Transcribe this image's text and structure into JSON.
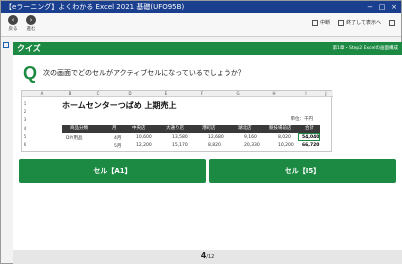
{
  "window": {
    "title": "【eラーニング】よくわかる Excel 2021 基礎(UFO95B)",
    "controls": [
      "−",
      "□",
      "×"
    ]
  },
  "toolbar": {
    "back_label": "戻る",
    "forward_label": "進む",
    "pause_label": "中断",
    "fullscreen_label": "終了して表示へ",
    "help_label": "?"
  },
  "quiz": {
    "title": "クイズ",
    "chapter": "第1章・Step2 Excelの画面構成",
    "q_mark": "Q",
    "question": "次の画面でどのセルがアクティブセルになっているでしょうか？"
  },
  "sheet": {
    "columns": [
      "A",
      "B",
      "C",
      "D",
      "E",
      "F",
      "G",
      "H",
      "I",
      "J"
    ],
    "rows": [
      "1",
      "2",
      "3",
      "4",
      "5",
      "6"
    ],
    "title": "ホームセンターつばめ 上期売上",
    "unit": "単位：千円",
    "headers": [
      "商品分類",
      "月",
      "中央店",
      "大通り店",
      "港町店",
      "湖北店",
      "競技場前店",
      "合計"
    ],
    "row1": [
      "DIY用品",
      "4月",
      "10,600",
      "13,580",
      "12,680",
      "9,160",
      "8,020",
      "54,040"
    ],
    "row2": [
      "",
      "5月",
      "12,200",
      "15,170",
      "8,820",
      "20,330",
      "10,200",
      "66,720"
    ]
  },
  "answers": [
    {
      "label": "セル【A1】"
    },
    {
      "label": "セル【I5】"
    }
  ],
  "footer": {
    "current": "4",
    "total": "/12"
  },
  "colors": {
    "green": "#1c8a43",
    "titlebar": "#1a3f8f"
  }
}
